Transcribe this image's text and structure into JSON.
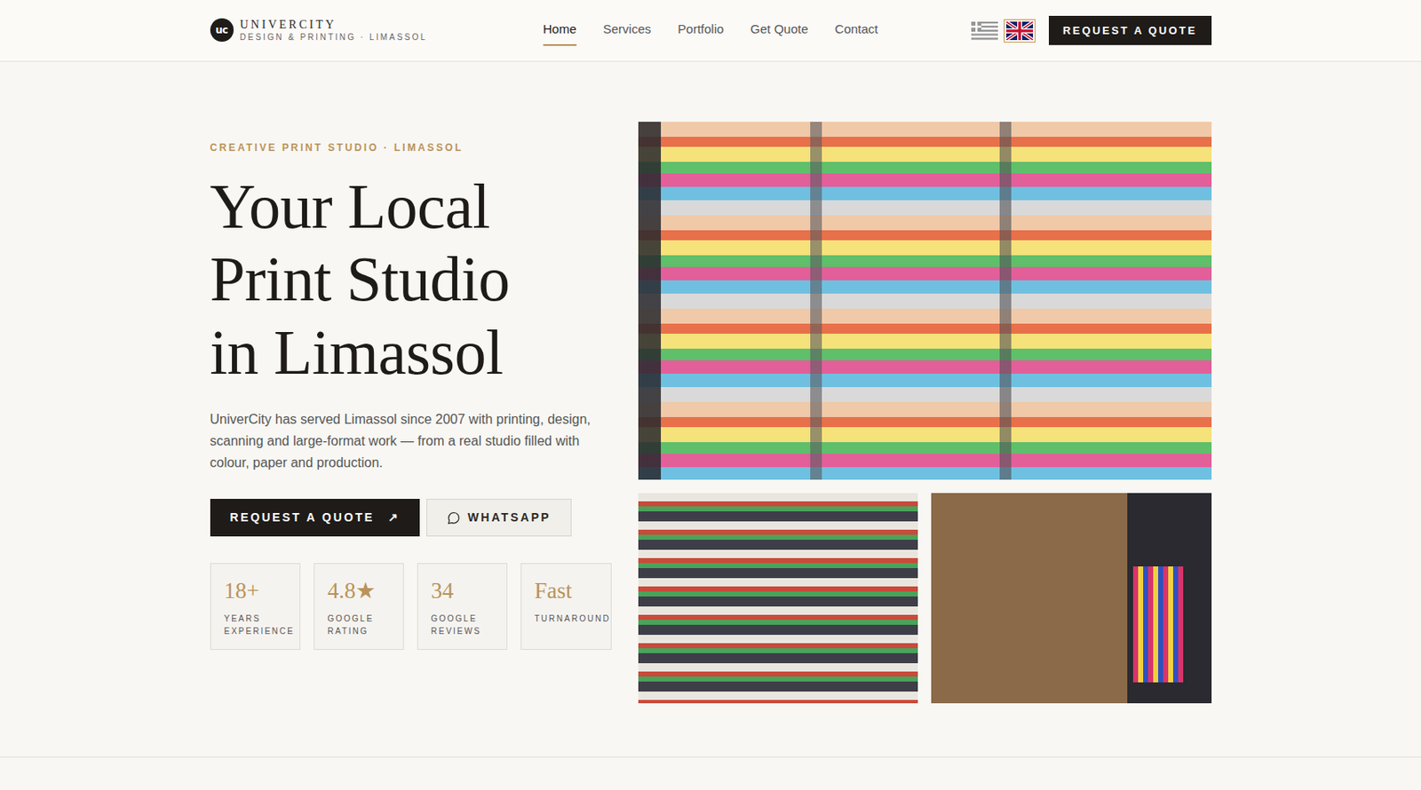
{
  "brand": {
    "mark": "uc",
    "name": "UNIVERCITY",
    "tagline": "DESIGN & PRINTING · LIMASSOL"
  },
  "nav": [
    {
      "label": "Home",
      "selected": true
    },
    {
      "label": "Services",
      "selected": false
    },
    {
      "label": "Portfolio",
      "selected": false
    },
    {
      "label": "Get Quote",
      "selected": false
    },
    {
      "label": "Contact",
      "selected": false
    }
  ],
  "languages": [
    {
      "kind": "greece",
      "selected": false
    },
    {
      "kind": "uk",
      "selected": true
    }
  ],
  "header_button": "REQUEST A QUOTE",
  "hero": {
    "eyebrow": "CREATIVE PRINT STUDIO · LIMASSOL",
    "title_lines": [
      "Your Local",
      "Print Studio",
      "in Limassol"
    ],
    "text": "UniverCity has served Limassol since 2007 with printing, design, scanning and large-format work — from a real studio filled with colour, paper and production.",
    "buttons": [
      {
        "label": "REQUEST A QUOTE",
        "icon": "↗"
      },
      {
        "label": "WHATSAPP"
      }
    ],
    "stats": [
      {
        "value": "18+",
        "label_lines": [
          "YEARS",
          "EXPERIENCE"
        ]
      },
      {
        "value": "4.8★",
        "label_lines": [
          "GOOGLE",
          "RATING"
        ]
      },
      {
        "value": "34",
        "label_lines": [
          "GOOGLE",
          "REVIEWS"
        ]
      },
      {
        "value": "Fast",
        "label_lines": [
          "TURNAROUND"
        ]
      }
    ]
  }
}
